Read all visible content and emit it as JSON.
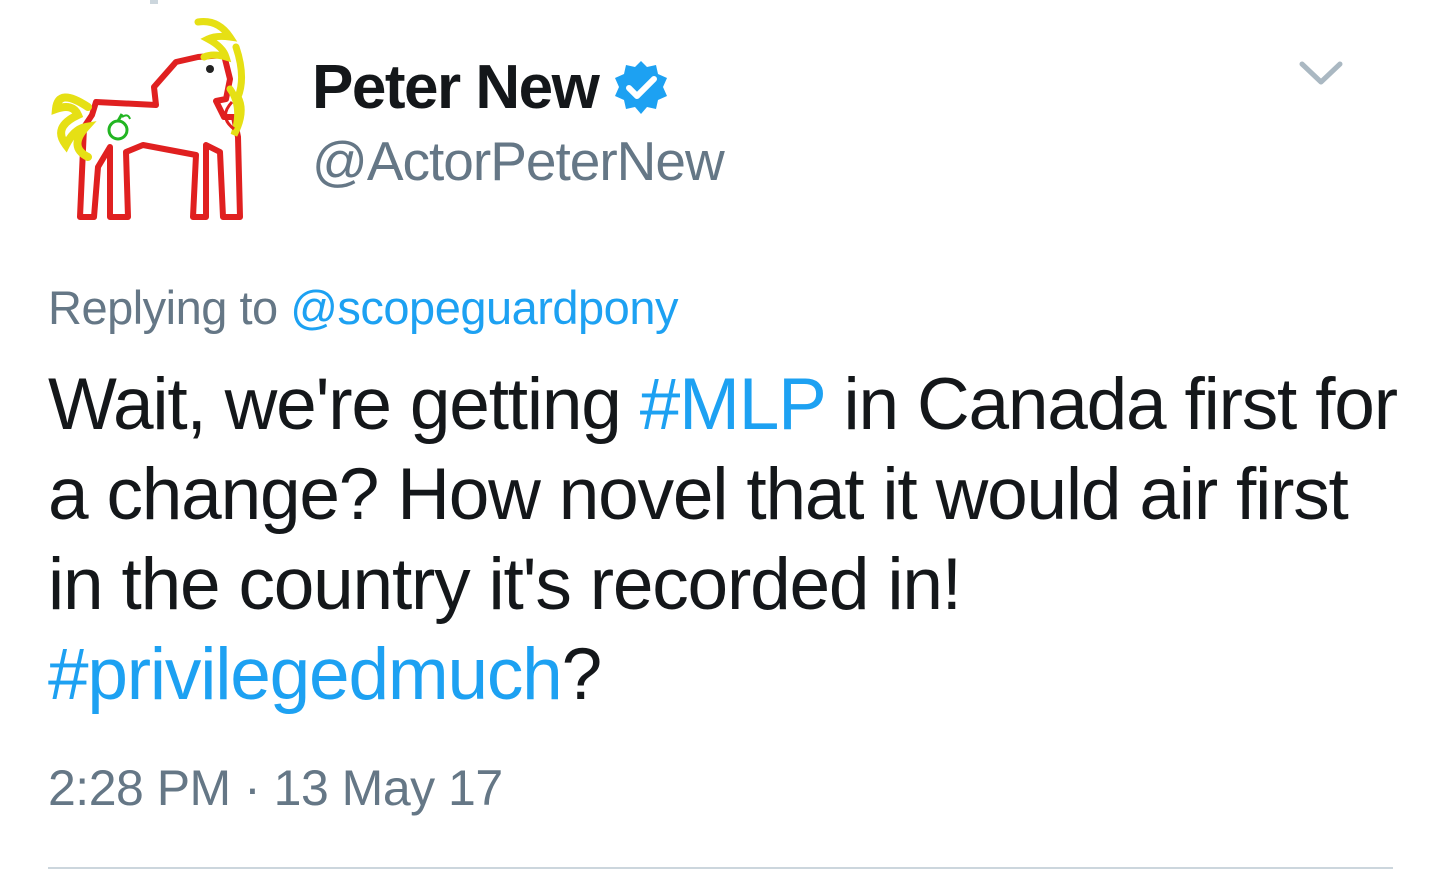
{
  "author": {
    "display_name": "Peter New",
    "handle": "@ActorPeterNew",
    "verified": true,
    "verified_icon": "verified-badge-icon",
    "avatar_icon": "drawn-pony-avatar"
  },
  "reply": {
    "prefix": "Replying to",
    "mention": "@scopeguardpony"
  },
  "tweet": {
    "part1": "Wait, we're getting ",
    "hashtag1": "#MLP",
    "part2": " in Canada first for a change? How novel that it would air first in the country it's recorded in! ",
    "hashtag2": "#privilegedmuch",
    "part3": "?"
  },
  "meta": {
    "time": "2:28 PM",
    "separator": " · ",
    "date": "13 May 17"
  },
  "icons": {
    "menu": "chevron-down-icon"
  },
  "colors": {
    "link": "#1da1f2",
    "text": "#14171a",
    "muted": "#657786",
    "divider": "#ccd6dd"
  }
}
